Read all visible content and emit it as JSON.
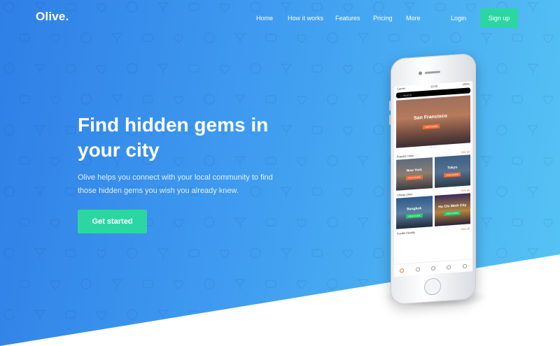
{
  "brand": {
    "logo": "Olive."
  },
  "nav": {
    "items": [
      "Home",
      "How it works",
      "Features",
      "Pricing",
      "More"
    ],
    "login": "Login",
    "signup": "Sign up"
  },
  "hero": {
    "headline": "Find hidden gems in your city",
    "subtext": "Olive helps you connect with your local community to find those hidden gems you wish you already knew.",
    "cta": "Get started"
  },
  "phone": {
    "status_left": "Carrier",
    "status_time": "12:00",
    "status_right": "100%",
    "search_placeholder": "Search",
    "featured_city": "San Francisco",
    "featured_badge": "VIEW GUIDE",
    "sections": [
      {
        "title": "Popular cities",
        "see_all": "See all",
        "tiles": [
          {
            "name": "New York",
            "badge": "VIEW GUIDE"
          },
          {
            "name": "Tokyo",
            "badge": "VIEW GUIDE"
          }
        ]
      },
      {
        "title": "Cheap cities",
        "see_all": "See all",
        "tiles": [
          {
            "name": "Bangkok",
            "badge": "VIEW GUIDE"
          },
          {
            "name": "Ho Chi Minh City",
            "badge": "VIEW GUIDE"
          }
        ]
      },
      {
        "title": "Foodie friendly",
        "see_all": "See all"
      }
    ]
  },
  "colors": {
    "accent": "#2cd6a2",
    "gradient_start": "#2f7fe6",
    "gradient_end": "#56c4f4",
    "app_accent": "#f26b3a"
  }
}
